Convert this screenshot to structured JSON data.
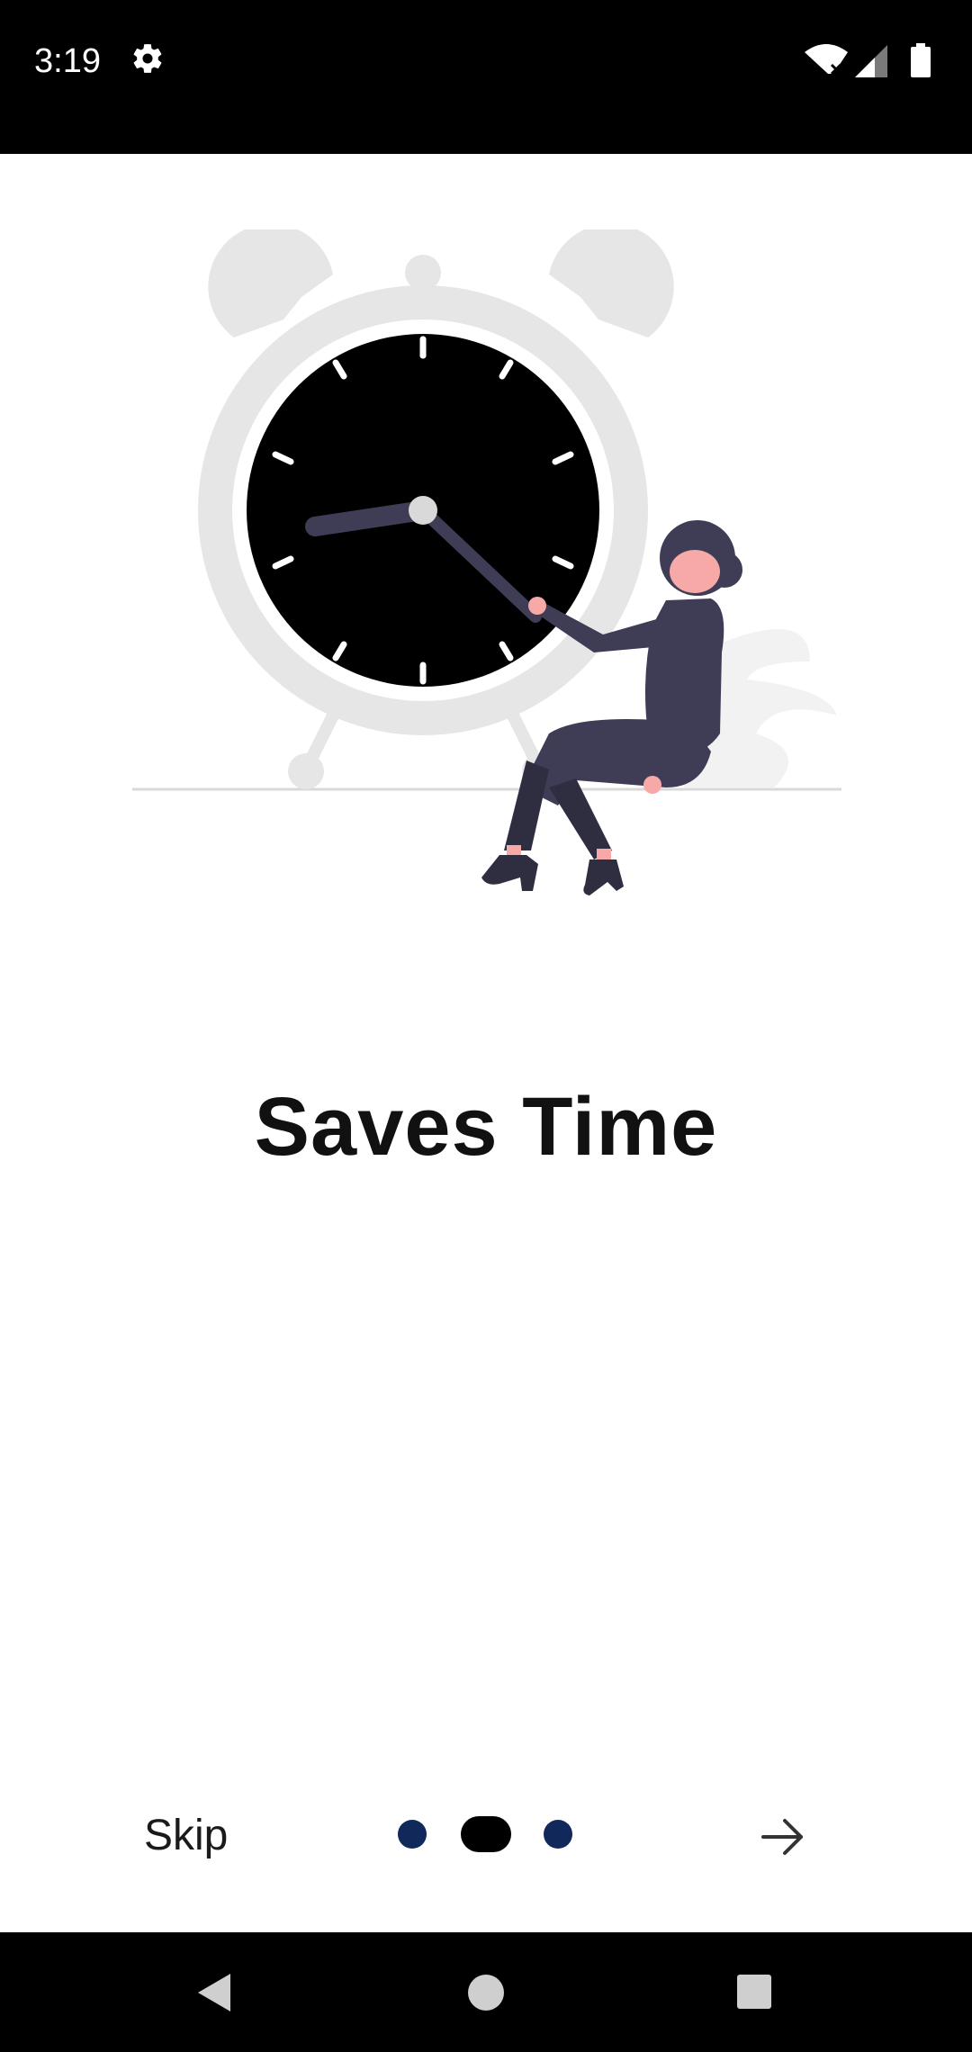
{
  "status_bar": {
    "time": "3:19",
    "icons": [
      "gear-icon",
      "wifi-icon",
      "cellular-signal-icon",
      "battery-icon"
    ]
  },
  "onboarding": {
    "illustration": "alarm-clock-with-person-illustration",
    "title": "Saves Time",
    "skip_label": "Skip",
    "page_indicator": {
      "count": 3,
      "active_index": 1
    },
    "next_icon": "arrow-right-icon"
  },
  "navigation_bar": {
    "icons": [
      "back-icon",
      "home-icon",
      "recents-icon"
    ]
  },
  "colors": {
    "status_bar_bg": "#000000",
    "background": "#ffffff",
    "title_text": "#111111",
    "dot_inactive": "#10285a",
    "dot_active": "#000000",
    "clock_rim": "#e6e6e6",
    "clock_face": "#000000",
    "figure_dark": "#3f3d56",
    "skin": "#f7a9a8"
  }
}
